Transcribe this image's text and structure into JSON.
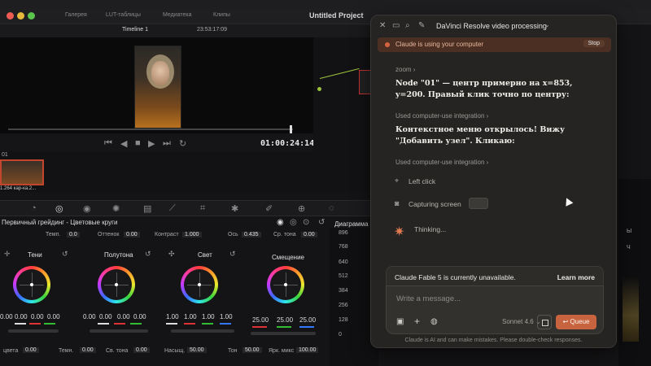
{
  "resolve": {
    "project_title": "Untitled Project",
    "menu": [
      "Галерея",
      "LUT-таблицы",
      "Медиатека",
      "Клипы"
    ],
    "timeline_name": "Timeline 1",
    "source_tc": "23:53:17:09",
    "timecode": "01:00:24:14",
    "clip": {
      "number": "01",
      "label": "1.264 кар-ка.2..."
    },
    "panel_title": "Первичный грейдинг - Цветовые круги",
    "scope_title": "Диаграмма",
    "top_params": {
      "temp_label": "Темп.",
      "temp_val": "0.0",
      "tint_label": "Оттенок",
      "tint_val": "0.00",
      "contrast_label": "Контраст",
      "contrast_val": "1.000",
      "pivot_label": "Ось",
      "pivot_val": "0.435",
      "midtone_label": "Ср. тона",
      "midtone_val": "0.00"
    },
    "wheels": [
      {
        "label": "Тени",
        "nums": [
          "0.00",
          "0.00",
          "0.00",
          "0.00"
        ]
      },
      {
        "label": "Полутона",
        "nums": [
          "0.00",
          "0.00",
          "0.00",
          "0.00"
        ]
      },
      {
        "label": "Свет",
        "nums": [
          "1.00",
          "1.00",
          "1.00",
          "1.00"
        ]
      },
      {
        "label": "Смещение",
        "nums": [
          "25.00",
          "25.00",
          "25.00"
        ]
      }
    ],
    "bottom_params": {
      "a_label": "цвета",
      "a_val": "0.00",
      "b_label": "Темн.",
      "b_val": "0.00",
      "c_label": "Св. тона",
      "c_val": "0.00",
      "d_label": "Насыщ.",
      "d_val": "50.00",
      "e_label": "Тон",
      "e_val": "50.00",
      "f_label": "Ярк. микс",
      "f_val": "100.00"
    },
    "scope_ticks": [
      "896",
      "768",
      "640",
      "512",
      "384",
      "256",
      "128",
      "0"
    ],
    "right_labels": [
      "Ы",
      "Ч"
    ]
  },
  "claude": {
    "title": "DaVinci Resolve video processing",
    "banner": "Claude is using your computer",
    "stop": "Stop",
    "zoom_label": "zoom",
    "msg1": "Node \"01\" — центр примерно на x=853, y=200. Правый клик точно по центру:",
    "used1": "Used computer-use integration",
    "msg2": "Контекстное меню открылось! Вижу \"Добавить узел\". Кликаю:",
    "used2": "Used computer-use integration",
    "left_click": "Left click",
    "capturing": "Capturing screen",
    "thinking": "Thinking...",
    "unavailable": "Claude Fable 5 is currently unavailable.",
    "learn_more": "Learn more",
    "placeholder": "Write a message...",
    "model": "Sonnet 4.6",
    "queue": "Queue",
    "footer": "Claude is AI and can make mistakes. Please double-check responses.",
    "accent": "#c7643f"
  }
}
